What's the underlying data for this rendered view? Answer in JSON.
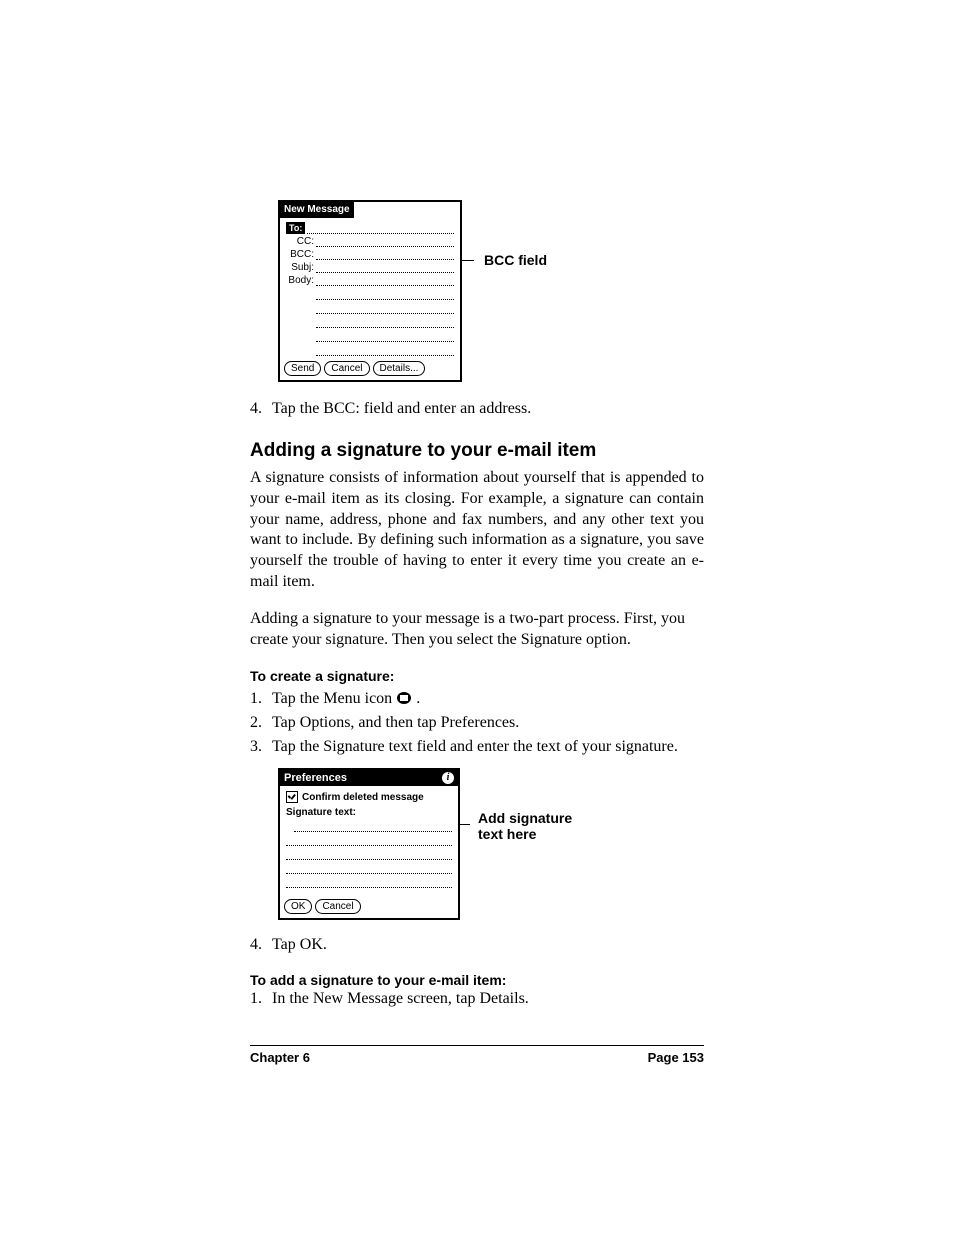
{
  "fig1": {
    "title": "New Message",
    "labels": {
      "to": "To:",
      "cc": "CC:",
      "bcc": "BCC:",
      "subj": "Subj:",
      "body": "Body:"
    },
    "buttons": {
      "send": "Send",
      "cancel": "Cancel",
      "details": "Details..."
    },
    "callout": "BCC field"
  },
  "step4a": {
    "num": "4.",
    "text": "Tap the BCC: field and enter an address."
  },
  "heading1": "Adding a signature to your e-mail item",
  "para1": "A signature consists of information about yourself that is appended to your e-mail item as its closing. For example, a signature can contain your name, address, phone and fax numbers, and any other text you want to include. By defining such information as a signature, you save yourself the trouble of having to enter it every time you create an e-mail item.",
  "para2": "Adding a signature to your message is a two-part process. First, you create your signature. Then you select the Signature option.",
  "sub1": "To create a signature:",
  "createSteps": {
    "s1": {
      "num": "1.",
      "pre": "Tap the Menu icon ",
      "post": " ."
    },
    "s2": {
      "num": "2.",
      "text": "Tap Options, and then tap Preferences."
    },
    "s3": {
      "num": "3.",
      "text": "Tap the Signature text field and enter the text of your signature."
    }
  },
  "fig2": {
    "title": "Preferences",
    "info": "i",
    "confirm": "Confirm deleted message",
    "sigLabel": "Signature text:",
    "buttons": {
      "ok": "OK",
      "cancel": "Cancel"
    },
    "callout_l1": "Add signature",
    "callout_l2": "text here"
  },
  "step4b": {
    "num": "4.",
    "text": "Tap OK."
  },
  "sub2": "To add a signature to your e-mail item:",
  "addStep1": {
    "num": "1.",
    "text": "In the New Message screen, tap Details."
  },
  "footer": {
    "left": "Chapter 6",
    "right": "Page 153"
  }
}
